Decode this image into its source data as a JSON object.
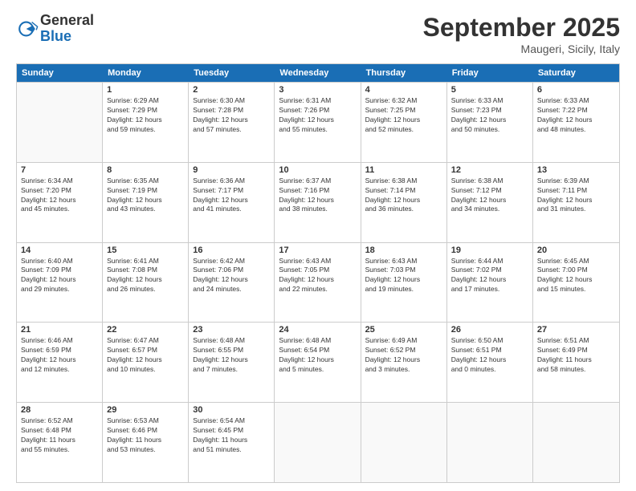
{
  "logo": {
    "general": "General",
    "blue": "Blue"
  },
  "title": "September 2025",
  "location": "Maugeri, Sicily, Italy",
  "days_of_week": [
    "Sunday",
    "Monday",
    "Tuesday",
    "Wednesday",
    "Thursday",
    "Friday",
    "Saturday"
  ],
  "weeks": [
    [
      {
        "day": "",
        "lines": []
      },
      {
        "day": "1",
        "lines": [
          "Sunrise: 6:29 AM",
          "Sunset: 7:29 PM",
          "Daylight: 12 hours",
          "and 59 minutes."
        ]
      },
      {
        "day": "2",
        "lines": [
          "Sunrise: 6:30 AM",
          "Sunset: 7:28 PM",
          "Daylight: 12 hours",
          "and 57 minutes."
        ]
      },
      {
        "day": "3",
        "lines": [
          "Sunrise: 6:31 AM",
          "Sunset: 7:26 PM",
          "Daylight: 12 hours",
          "and 55 minutes."
        ]
      },
      {
        "day": "4",
        "lines": [
          "Sunrise: 6:32 AM",
          "Sunset: 7:25 PM",
          "Daylight: 12 hours",
          "and 52 minutes."
        ]
      },
      {
        "day": "5",
        "lines": [
          "Sunrise: 6:33 AM",
          "Sunset: 7:23 PM",
          "Daylight: 12 hours",
          "and 50 minutes."
        ]
      },
      {
        "day": "6",
        "lines": [
          "Sunrise: 6:33 AM",
          "Sunset: 7:22 PM",
          "Daylight: 12 hours",
          "and 48 minutes."
        ]
      }
    ],
    [
      {
        "day": "7",
        "lines": [
          "Sunrise: 6:34 AM",
          "Sunset: 7:20 PM",
          "Daylight: 12 hours",
          "and 45 minutes."
        ]
      },
      {
        "day": "8",
        "lines": [
          "Sunrise: 6:35 AM",
          "Sunset: 7:19 PM",
          "Daylight: 12 hours",
          "and 43 minutes."
        ]
      },
      {
        "day": "9",
        "lines": [
          "Sunrise: 6:36 AM",
          "Sunset: 7:17 PM",
          "Daylight: 12 hours",
          "and 41 minutes."
        ]
      },
      {
        "day": "10",
        "lines": [
          "Sunrise: 6:37 AM",
          "Sunset: 7:16 PM",
          "Daylight: 12 hours",
          "and 38 minutes."
        ]
      },
      {
        "day": "11",
        "lines": [
          "Sunrise: 6:38 AM",
          "Sunset: 7:14 PM",
          "Daylight: 12 hours",
          "and 36 minutes."
        ]
      },
      {
        "day": "12",
        "lines": [
          "Sunrise: 6:38 AM",
          "Sunset: 7:12 PM",
          "Daylight: 12 hours",
          "and 34 minutes."
        ]
      },
      {
        "day": "13",
        "lines": [
          "Sunrise: 6:39 AM",
          "Sunset: 7:11 PM",
          "Daylight: 12 hours",
          "and 31 minutes."
        ]
      }
    ],
    [
      {
        "day": "14",
        "lines": [
          "Sunrise: 6:40 AM",
          "Sunset: 7:09 PM",
          "Daylight: 12 hours",
          "and 29 minutes."
        ]
      },
      {
        "day": "15",
        "lines": [
          "Sunrise: 6:41 AM",
          "Sunset: 7:08 PM",
          "Daylight: 12 hours",
          "and 26 minutes."
        ]
      },
      {
        "day": "16",
        "lines": [
          "Sunrise: 6:42 AM",
          "Sunset: 7:06 PM",
          "Daylight: 12 hours",
          "and 24 minutes."
        ]
      },
      {
        "day": "17",
        "lines": [
          "Sunrise: 6:43 AM",
          "Sunset: 7:05 PM",
          "Daylight: 12 hours",
          "and 22 minutes."
        ]
      },
      {
        "day": "18",
        "lines": [
          "Sunrise: 6:43 AM",
          "Sunset: 7:03 PM",
          "Daylight: 12 hours",
          "and 19 minutes."
        ]
      },
      {
        "day": "19",
        "lines": [
          "Sunrise: 6:44 AM",
          "Sunset: 7:02 PM",
          "Daylight: 12 hours",
          "and 17 minutes."
        ]
      },
      {
        "day": "20",
        "lines": [
          "Sunrise: 6:45 AM",
          "Sunset: 7:00 PM",
          "Daylight: 12 hours",
          "and 15 minutes."
        ]
      }
    ],
    [
      {
        "day": "21",
        "lines": [
          "Sunrise: 6:46 AM",
          "Sunset: 6:59 PM",
          "Daylight: 12 hours",
          "and 12 minutes."
        ]
      },
      {
        "day": "22",
        "lines": [
          "Sunrise: 6:47 AM",
          "Sunset: 6:57 PM",
          "Daylight: 12 hours",
          "and 10 minutes."
        ]
      },
      {
        "day": "23",
        "lines": [
          "Sunrise: 6:48 AM",
          "Sunset: 6:55 PM",
          "Daylight: 12 hours",
          "and 7 minutes."
        ]
      },
      {
        "day": "24",
        "lines": [
          "Sunrise: 6:48 AM",
          "Sunset: 6:54 PM",
          "Daylight: 12 hours",
          "and 5 minutes."
        ]
      },
      {
        "day": "25",
        "lines": [
          "Sunrise: 6:49 AM",
          "Sunset: 6:52 PM",
          "Daylight: 12 hours",
          "and 3 minutes."
        ]
      },
      {
        "day": "26",
        "lines": [
          "Sunrise: 6:50 AM",
          "Sunset: 6:51 PM",
          "Daylight: 12 hours",
          "and 0 minutes."
        ]
      },
      {
        "day": "27",
        "lines": [
          "Sunrise: 6:51 AM",
          "Sunset: 6:49 PM",
          "Daylight: 11 hours",
          "and 58 minutes."
        ]
      }
    ],
    [
      {
        "day": "28",
        "lines": [
          "Sunrise: 6:52 AM",
          "Sunset: 6:48 PM",
          "Daylight: 11 hours",
          "and 55 minutes."
        ]
      },
      {
        "day": "29",
        "lines": [
          "Sunrise: 6:53 AM",
          "Sunset: 6:46 PM",
          "Daylight: 11 hours",
          "and 53 minutes."
        ]
      },
      {
        "day": "30",
        "lines": [
          "Sunrise: 6:54 AM",
          "Sunset: 6:45 PM",
          "Daylight: 11 hours",
          "and 51 minutes."
        ]
      },
      {
        "day": "",
        "lines": []
      },
      {
        "day": "",
        "lines": []
      },
      {
        "day": "",
        "lines": []
      },
      {
        "day": "",
        "lines": []
      }
    ]
  ]
}
